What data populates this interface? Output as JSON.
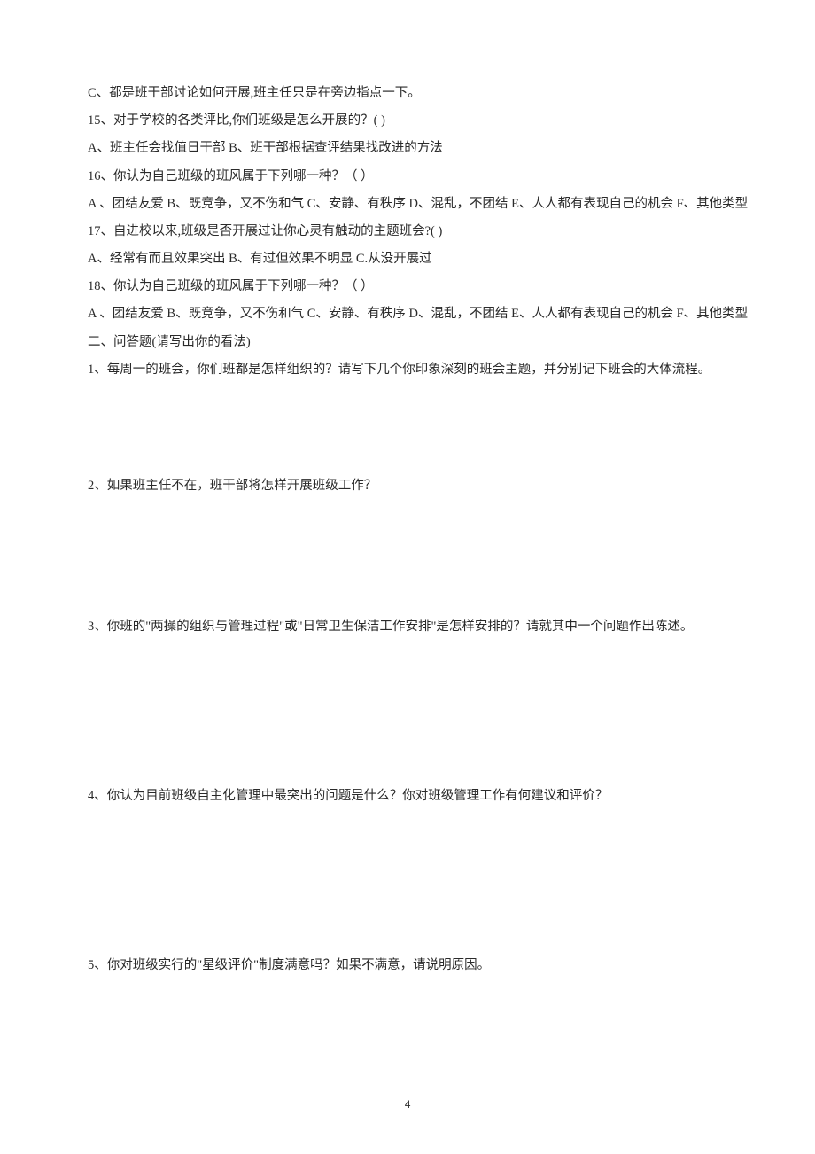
{
  "lines": {
    "l1": "C、都是班干部讨论如何开展,班主任只是在旁边指点一下。",
    "l2": "15、对于学校的各类评比,你们班级是怎么开展的？(        )",
    "l3": "A、班主任会找值日干部   B、班干部根据查评结果找改进的方法",
    "l4": "16、你认为自己班级的班风属于下列哪一种？（        ）",
    "l5": "A 、团结友爱      B、既竞争，又不伤和气    C、安静、有秩序     D、混乱，不团结    E、人人都有表现自己的机会        F、其他类型",
    "l6": "17、自进校以来,班级是否开展过让你心灵有触动的主题班会?(     )",
    "l7": "A、经常有而且效果突出   B、有过但效果不明显  C.从没开展过",
    "l8": "18、你认为自己班级的班风属于下列哪一种？（        ）",
    "l9": "A 、团结友爱      B、既竞争，又不伤和气    C、安静、有秩序     D、混乱，不团结    E、人人都有表现自己的机会        F、其他类型",
    "l10": "二、问答题(请写出你的看法)",
    "l11": "1、每周一的班会，你们班都是怎样组织的？请写下几个你印象深刻的班会主题，并分别记下班会的大体流程。",
    "l12": "2、如果班主任不在，班干部将怎样开展班级工作？",
    "l13": "3、你班的\"两操的组织与管理过程\"或\"日常卫生保洁工作安排\"是怎样安排的？请就其中一个问题作出陈述。",
    "l14": "4、你认为目前班级自主化管理中最突出的问题是什么？你对班级管理工作有何建议和评价？",
    "l15": "5、你对班级实行的\"星级评价\"制度满意吗？如果不满意，请说明原因。"
  },
  "page_number": "4"
}
